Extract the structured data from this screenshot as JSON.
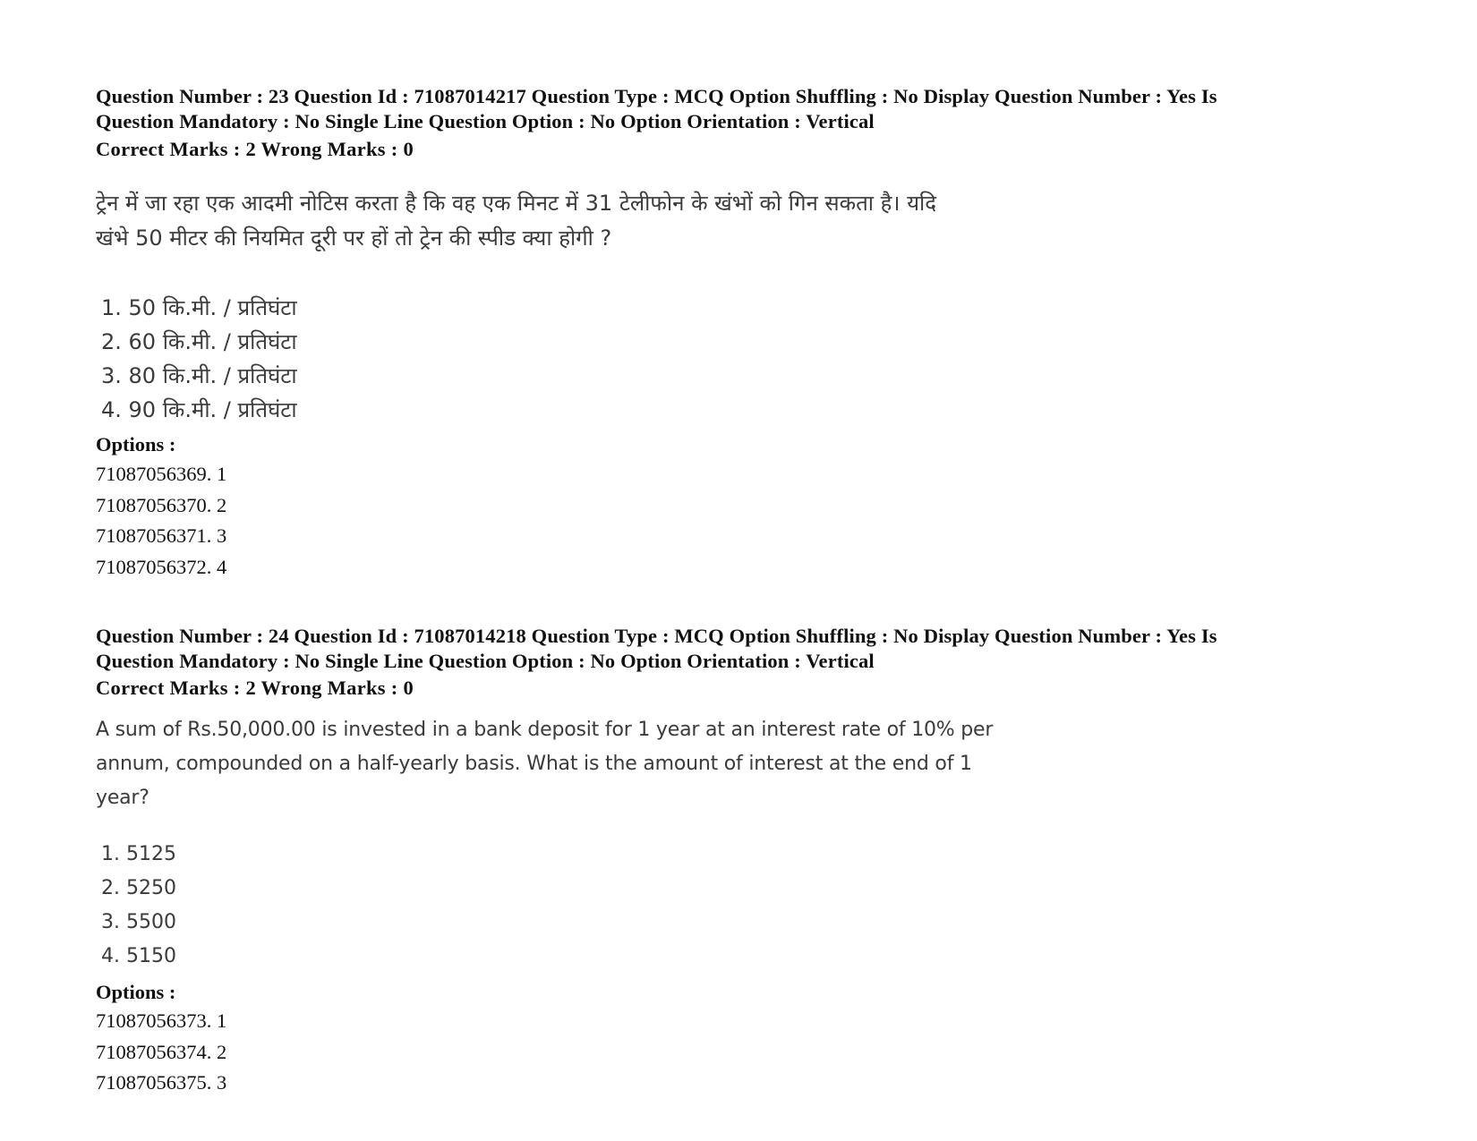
{
  "questions": [
    {
      "meta_line1": "Question Number : 23 Question Id : 71087014217 Question Type : MCQ Option Shuffling : No Display Question Number : Yes Is",
      "meta_line2": "Question Mandatory : No Single Line Question Option : No Option Orientation : Vertical",
      "marks": "Correct Marks : 2 Wrong Marks : 0",
      "text_line1": "ट्रेन में जा रहा एक आदमी नोटिस करता है कि वह एक मिनट में 31 टेलीफोन के खंभों को गिन सकता है। यदि",
      "text_line2": "खंभे 50 मीटर की नियमित दूरी पर हों तो ट्रेन की स्पीड क्या होगी ?",
      "text_line3": "",
      "choices": [
        "1. 50 कि.मी. / प्रतिघंटा",
        "2. 60 कि.मी. / प्रतिघंटा",
        "3. 80 कि.मी. / प्रतिघंटा",
        "4. 90 कि.मी. / प्रतिघंटा"
      ],
      "options_label": "Options :",
      "option_ids": [
        "71087056369. 1",
        "71087056370. 2",
        "71087056371. 3",
        "71087056372. 4"
      ]
    },
    {
      "meta_line1": "Question Number : 24 Question Id : 71087014218 Question Type : MCQ Option Shuffling : No Display Question Number : Yes Is",
      "meta_line2": "Question Mandatory : No Single Line Question Option : No Option Orientation : Vertical",
      "marks": "Correct Marks : 2 Wrong Marks : 0",
      "text_line1": "A sum of Rs.50,000.00 is invested in a bank deposit for 1 year at an interest rate of 10% per",
      "text_line2": "annum, compounded on a half-yearly basis. What is the amount of interest at the end of 1",
      "text_line3": "year?",
      "choices": [
        "1. 5125",
        "2. 5250",
        "3. 5500",
        "4. 5150"
      ],
      "options_label": "Options :",
      "option_ids": [
        "71087056373. 1",
        "71087056374. 2",
        "71087056375. 3"
      ]
    }
  ]
}
